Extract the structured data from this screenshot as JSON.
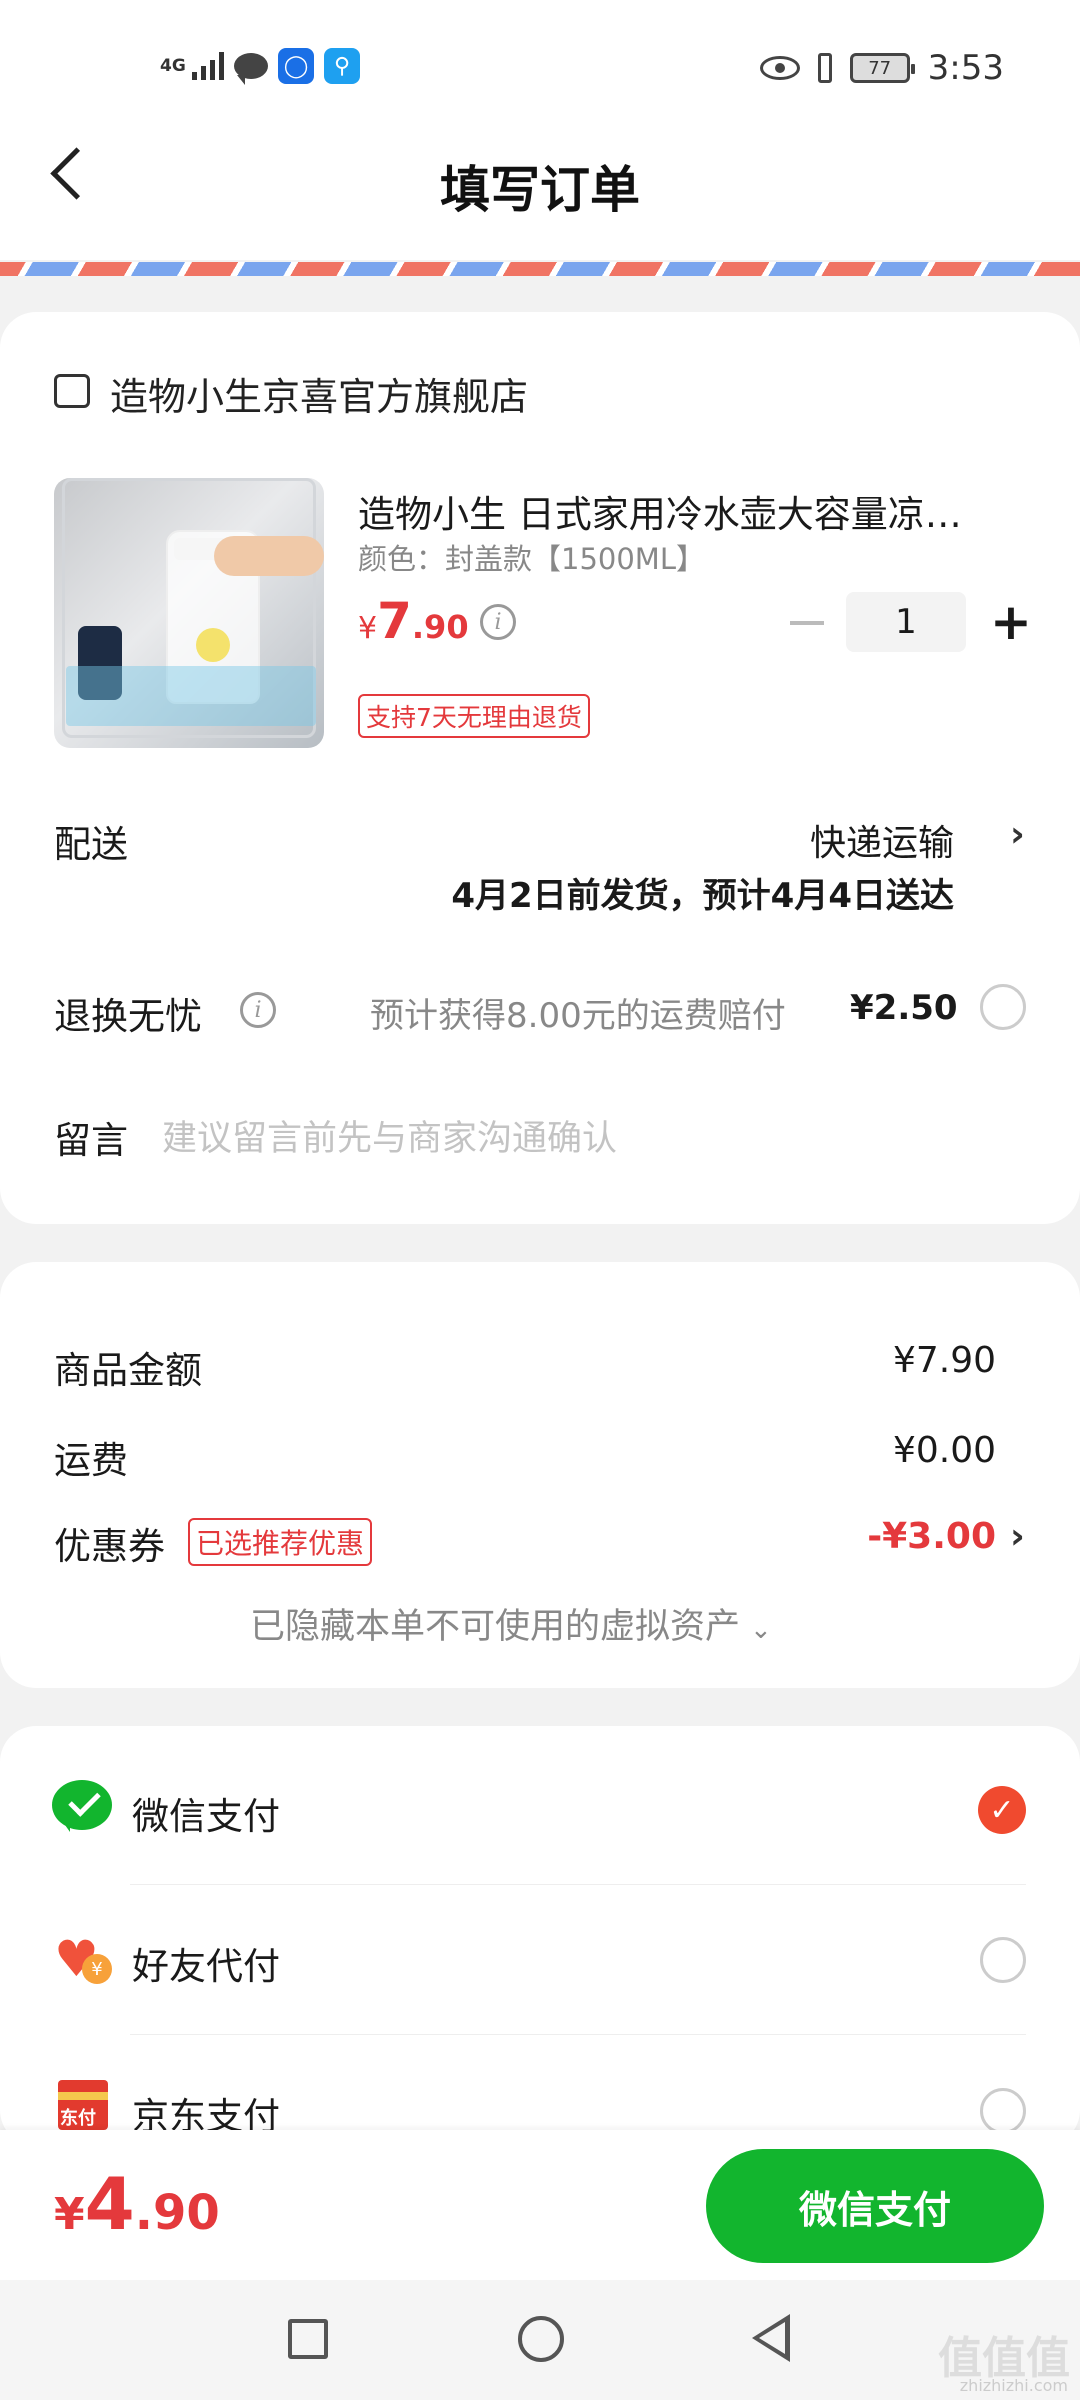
{
  "status_bar": {
    "network": "4G",
    "time": "3:53",
    "battery": "77"
  },
  "header": {
    "title": "填写订单"
  },
  "store": {
    "name": "造物小生京喜官方旗舰店"
  },
  "product": {
    "title": "造物小生 日式家用冷水壶大容量凉…",
    "spec": "颜色：封盖款【1500ML】",
    "price_symbol": "¥",
    "price_int": "7",
    "price_dec": ".90",
    "quantity": "1",
    "return_tag": "支持7天无理由退货"
  },
  "delivery": {
    "label": "配送",
    "method": "快递运输",
    "schedule": "4月2日前发货，预计4月4日送达"
  },
  "return_insurance": {
    "label": "退换无忧",
    "desc": "预计获得8.00元的运费赔付",
    "price": "¥2.50"
  },
  "message": {
    "label": "留言",
    "placeholder": "建议留言前先与商家沟通确认"
  },
  "summary": {
    "goods_label": "商品金额",
    "goods_value": "¥7.90",
    "shipping_label": "运费",
    "shipping_value": "¥0.00",
    "coupon_label": "优惠券",
    "coupon_tag": "已选推荐优惠",
    "coupon_value": "-¥3.00",
    "hidden_assets": "已隐藏本单不可使用的虚拟资产"
  },
  "payment": {
    "methods": [
      {
        "label": "微信支付",
        "selected": true
      },
      {
        "label": "好友代付",
        "selected": false
      },
      {
        "label": "京东支付",
        "selected": false
      }
    ],
    "jd_icon_text": "东付"
  },
  "footer": {
    "total_symbol": "¥",
    "total_int": "4",
    "total_dec": ".90",
    "pay_button": "微信支付"
  },
  "watermark": {
    "mark": "值值值",
    "site": "zhizhizhi.com"
  },
  "colors": {
    "accent_red": "#e4393c",
    "wechat_green": "#12b52e",
    "radio_selected": "#f04a2f"
  }
}
